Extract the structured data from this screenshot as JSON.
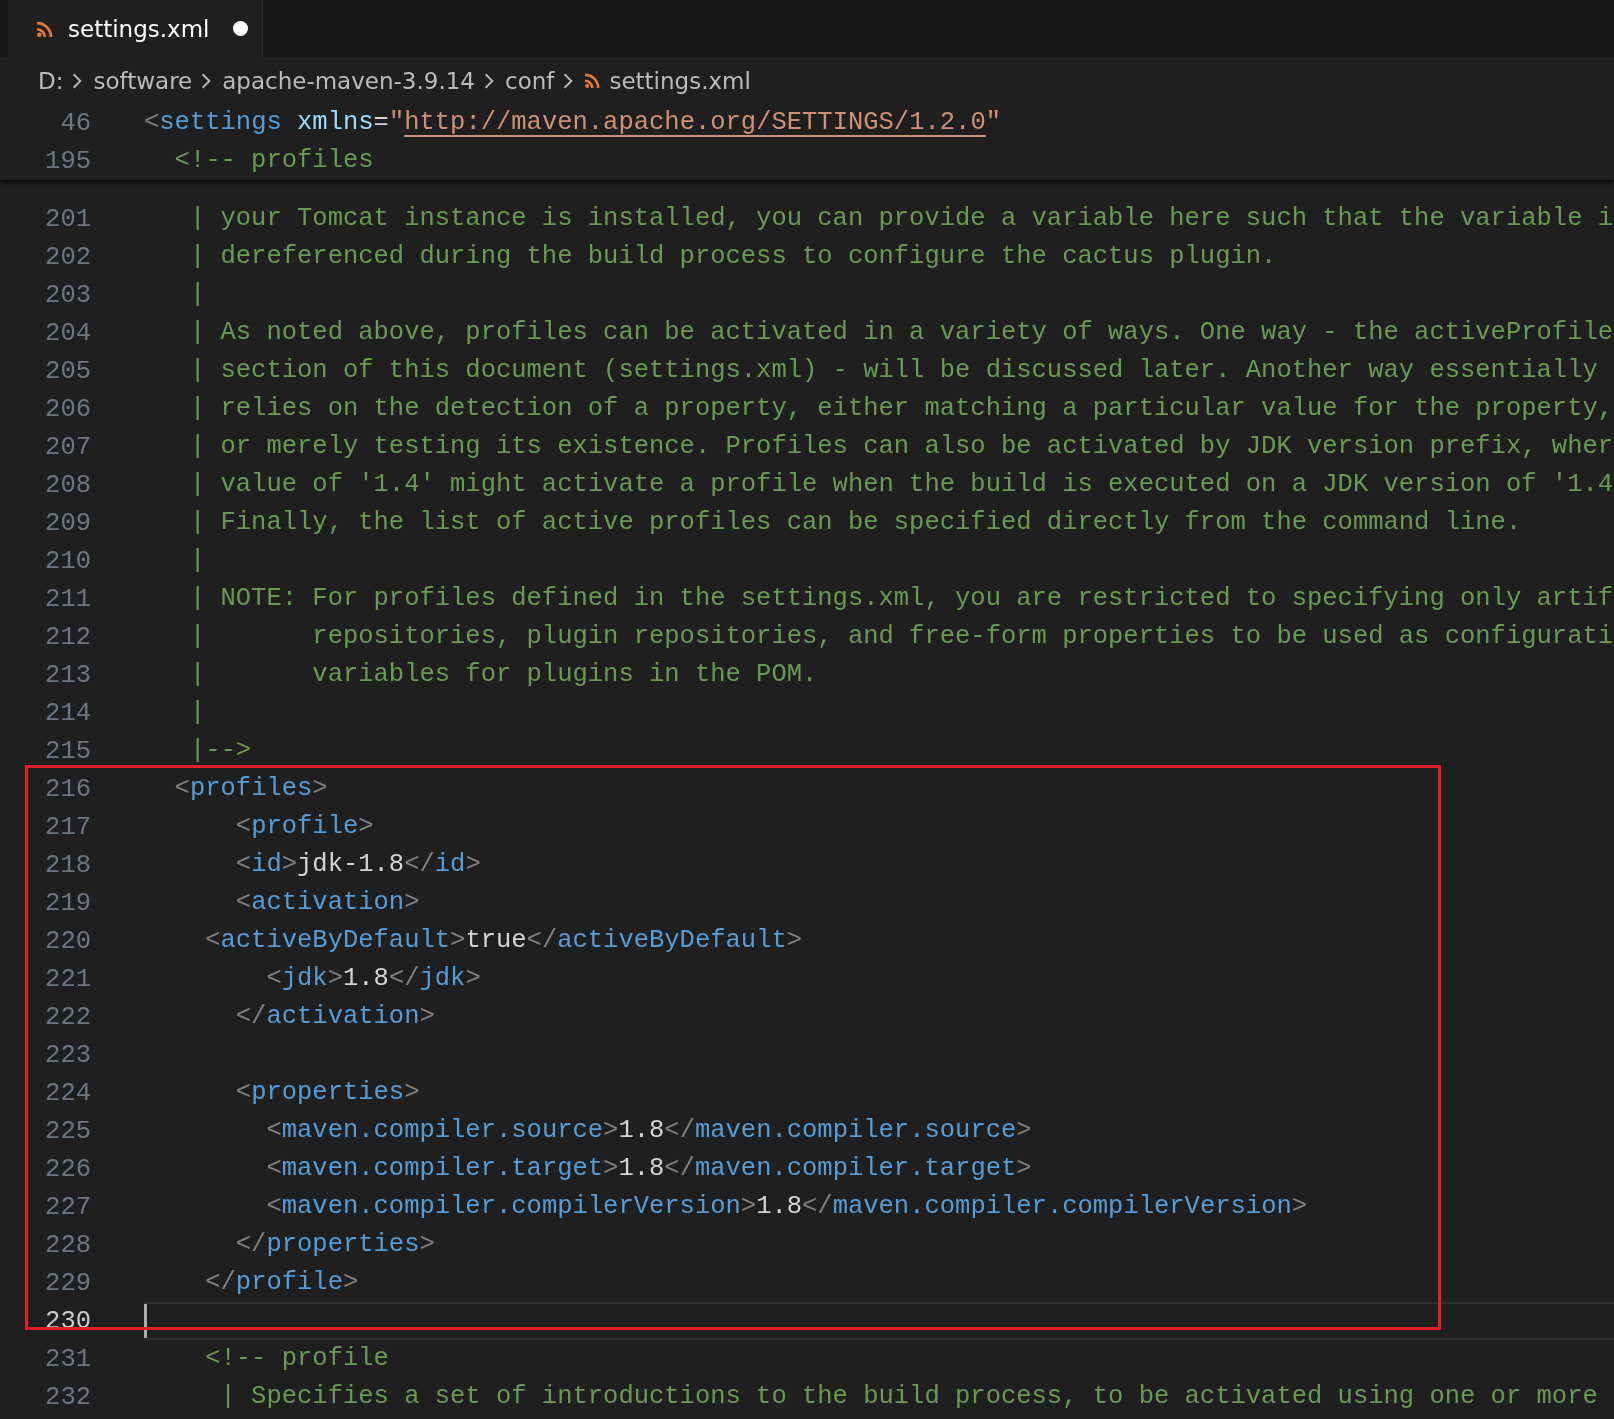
{
  "tab": {
    "label": "settings.xml",
    "modified": true,
    "selected": true
  },
  "breadcrumb": [
    {
      "label": "D:",
      "kind": "folder"
    },
    {
      "label": "software",
      "kind": "folder"
    },
    {
      "label": "apache-maven-3.9.14",
      "kind": "folder"
    },
    {
      "label": "conf",
      "kind": "folder"
    },
    {
      "label": "settings.xml",
      "kind": "file"
    }
  ],
  "sticky_lines": [
    {
      "number": "46",
      "tokens": [
        {
          "kind": "bracket",
          "text": "<"
        },
        {
          "kind": "tag",
          "text": "settings"
        },
        {
          "kind": "attr",
          "text": " xmlns"
        },
        {
          "kind": "text",
          "text": "="
        },
        {
          "kind": "string",
          "text": "\""
        },
        {
          "kind": "link",
          "text": "http://maven.apache.org/SETTINGS/1.2.0"
        },
        {
          "kind": "string",
          "text": "\""
        }
      ]
    },
    {
      "number": "195",
      "tokens": [
        {
          "kind": "comment",
          "text": "  <!-- profiles"
        }
      ]
    }
  ],
  "lines_above": [
    {
      "number": "201",
      "current": false,
      "tokens": [
        {
          "kind": "comment",
          "text": "   | your Tomcat instance is installed, you can provide a variable here such that the variable i"
        }
      ]
    },
    {
      "number": "202",
      "current": false,
      "tokens": [
        {
          "kind": "comment",
          "text": "   | dereferenced during the build process to configure the cactus plugin."
        }
      ]
    },
    {
      "number": "203",
      "current": false,
      "tokens": [
        {
          "kind": "comment",
          "text": "   |"
        }
      ]
    },
    {
      "number": "204",
      "current": false,
      "tokens": [
        {
          "kind": "comment",
          "text": "   | As noted above, profiles can be activated in a variety of ways. One way - the activeProfile"
        }
      ]
    },
    {
      "number": "205",
      "current": false,
      "tokens": [
        {
          "kind": "comment",
          "text": "   | section of this document (settings.xml) - will be discussed later. Another way essentially"
        }
      ]
    },
    {
      "number": "206",
      "current": false,
      "tokens": [
        {
          "kind": "comment",
          "text": "   | relies on the detection of a property, either matching a particular value for the property,"
        }
      ]
    },
    {
      "number": "207",
      "current": false,
      "tokens": [
        {
          "kind": "comment",
          "text": "   | or merely testing its existence. Profiles can also be activated by JDK version prefix, wher"
        }
      ]
    },
    {
      "number": "208",
      "current": false,
      "tokens": [
        {
          "kind": "comment",
          "text": "   | value of '1.4' might activate a profile when the build is executed on a JDK version of '1.4"
        }
      ]
    },
    {
      "number": "209",
      "current": false,
      "tokens": [
        {
          "kind": "comment",
          "text": "   | Finally, the list of active profiles can be specified directly from the command line."
        }
      ]
    },
    {
      "number": "210",
      "current": false,
      "tokens": [
        {
          "kind": "comment",
          "text": "   |"
        }
      ]
    },
    {
      "number": "211",
      "current": false,
      "tokens": [
        {
          "kind": "comment",
          "text": "   | NOTE: For profiles defined in the settings.xml, you are restricted to specifying only artif"
        }
      ]
    },
    {
      "number": "212",
      "current": false,
      "tokens": [
        {
          "kind": "comment",
          "text": "   |       repositories, plugin repositories, and free-form properties to be used as configurati"
        }
      ]
    },
    {
      "number": "213",
      "current": false,
      "tokens": [
        {
          "kind": "comment",
          "text": "   |       variables for plugins in the POM."
        }
      ]
    },
    {
      "number": "214",
      "current": false,
      "tokens": [
        {
          "kind": "comment",
          "text": "   |"
        }
      ]
    },
    {
      "number": "215",
      "current": false,
      "tokens": [
        {
          "kind": "comment",
          "text": "   |-->"
        }
      ]
    }
  ],
  "framed_lines": [
    {
      "number": "216",
      "current": false,
      "tokens": [
        {
          "kind": "bracket",
          "text": "  <"
        },
        {
          "kind": "tag",
          "text": "profiles"
        },
        {
          "kind": "bracket",
          "text": ">"
        }
      ]
    },
    {
      "number": "217",
      "current": false,
      "tokens": [
        {
          "kind": "bracket",
          "text": "      <"
        },
        {
          "kind": "tag",
          "text": "profile"
        },
        {
          "kind": "bracket",
          "text": ">"
        }
      ]
    },
    {
      "number": "218",
      "current": false,
      "tokens": [
        {
          "kind": "bracket",
          "text": "      <"
        },
        {
          "kind": "tag",
          "text": "id"
        },
        {
          "kind": "bracket",
          "text": ">"
        },
        {
          "kind": "text",
          "text": "jdk-1.8"
        },
        {
          "kind": "bracket",
          "text": "</"
        },
        {
          "kind": "tag",
          "text": "id"
        },
        {
          "kind": "bracket",
          "text": ">"
        }
      ]
    },
    {
      "number": "219",
      "current": false,
      "tokens": [
        {
          "kind": "bracket",
          "text": "      <"
        },
        {
          "kind": "tag",
          "text": "activation"
        },
        {
          "kind": "bracket",
          "text": ">"
        }
      ]
    },
    {
      "number": "220",
      "current": false,
      "tokens": [
        {
          "kind": "bracket",
          "text": "    <"
        },
        {
          "kind": "tag",
          "text": "activeByDefault"
        },
        {
          "kind": "bracket",
          "text": ">"
        },
        {
          "kind": "text",
          "text": "true"
        },
        {
          "kind": "bracket",
          "text": "</"
        },
        {
          "kind": "tag",
          "text": "activeByDefault"
        },
        {
          "kind": "bracket",
          "text": ">"
        }
      ]
    },
    {
      "number": "221",
      "current": false,
      "tokens": [
        {
          "kind": "bracket",
          "text": "        <"
        },
        {
          "kind": "tag",
          "text": "jdk"
        },
        {
          "kind": "bracket",
          "text": ">"
        },
        {
          "kind": "text",
          "text": "1.8"
        },
        {
          "kind": "bracket",
          "text": "</"
        },
        {
          "kind": "tag",
          "text": "jdk"
        },
        {
          "kind": "bracket",
          "text": ">"
        }
      ]
    },
    {
      "number": "222",
      "current": false,
      "tokens": [
        {
          "kind": "bracket",
          "text": "      </"
        },
        {
          "kind": "tag",
          "text": "activation"
        },
        {
          "kind": "bracket",
          "text": ">"
        }
      ]
    },
    {
      "number": "223",
      "current": false
    },
    {
      "number": "224",
      "current": false,
      "tokens": [
        {
          "kind": "bracket",
          "text": "      <"
        },
        {
          "kind": "tag",
          "text": "properties"
        },
        {
          "kind": "bracket",
          "text": ">"
        }
      ]
    },
    {
      "number": "225",
      "current": false,
      "tokens": [
        {
          "kind": "bracket",
          "text": "        <"
        },
        {
          "kind": "tag",
          "text": "maven.compiler.source"
        },
        {
          "kind": "bracket",
          "text": ">"
        },
        {
          "kind": "text",
          "text": "1.8"
        },
        {
          "kind": "bracket",
          "text": "</"
        },
        {
          "kind": "tag",
          "text": "maven.compiler.source"
        },
        {
          "kind": "bracket",
          "text": ">"
        }
      ]
    },
    {
      "number": "226",
      "current": false,
      "tokens": [
        {
          "kind": "bracket",
          "text": "        <"
        },
        {
          "kind": "tag",
          "text": "maven.compiler.target"
        },
        {
          "kind": "bracket",
          "text": ">"
        },
        {
          "kind": "text",
          "text": "1.8"
        },
        {
          "kind": "bracket",
          "text": "</"
        },
        {
          "kind": "tag",
          "text": "maven.compiler.target"
        },
        {
          "kind": "bracket",
          "text": ">"
        }
      ]
    },
    {
      "number": "227",
      "current": false,
      "tokens": [
        {
          "kind": "bracket",
          "text": "        <"
        },
        {
          "kind": "tag",
          "text": "maven.compiler.compilerVersion"
        },
        {
          "kind": "bracket",
          "text": ">"
        },
        {
          "kind": "text",
          "text": "1.8"
        },
        {
          "kind": "bracket",
          "text": "</"
        },
        {
          "kind": "tag",
          "text": "maven.compiler.compilerVersion"
        },
        {
          "kind": "bracket",
          "text": ">"
        }
      ]
    },
    {
      "number": "228",
      "current": false,
      "tokens": [
        {
          "kind": "bracket",
          "text": "      </"
        },
        {
          "kind": "tag",
          "text": "properties"
        },
        {
          "kind": "bracket",
          "text": ">"
        }
      ]
    },
    {
      "number": "229",
      "current": false,
      "tokens": [
        {
          "kind": "bracket",
          "text": "    </"
        },
        {
          "kind": "tag",
          "text": "profile"
        },
        {
          "kind": "bracket",
          "text": ">"
        }
      ]
    },
    {
      "number": "230",
      "current": true
    }
  ],
  "lines_below": [
    {
      "number": "231",
      "current": false,
      "tokens": [
        {
          "kind": "comment",
          "text": "    <!-- profile"
        }
      ]
    },
    {
      "number": "232",
      "current": false,
      "tokens": [
        {
          "kind": "comment",
          "text": "     | Specifies a set of introductions to the build process, to be activated using one or more"
        }
      ]
    }
  ]
}
